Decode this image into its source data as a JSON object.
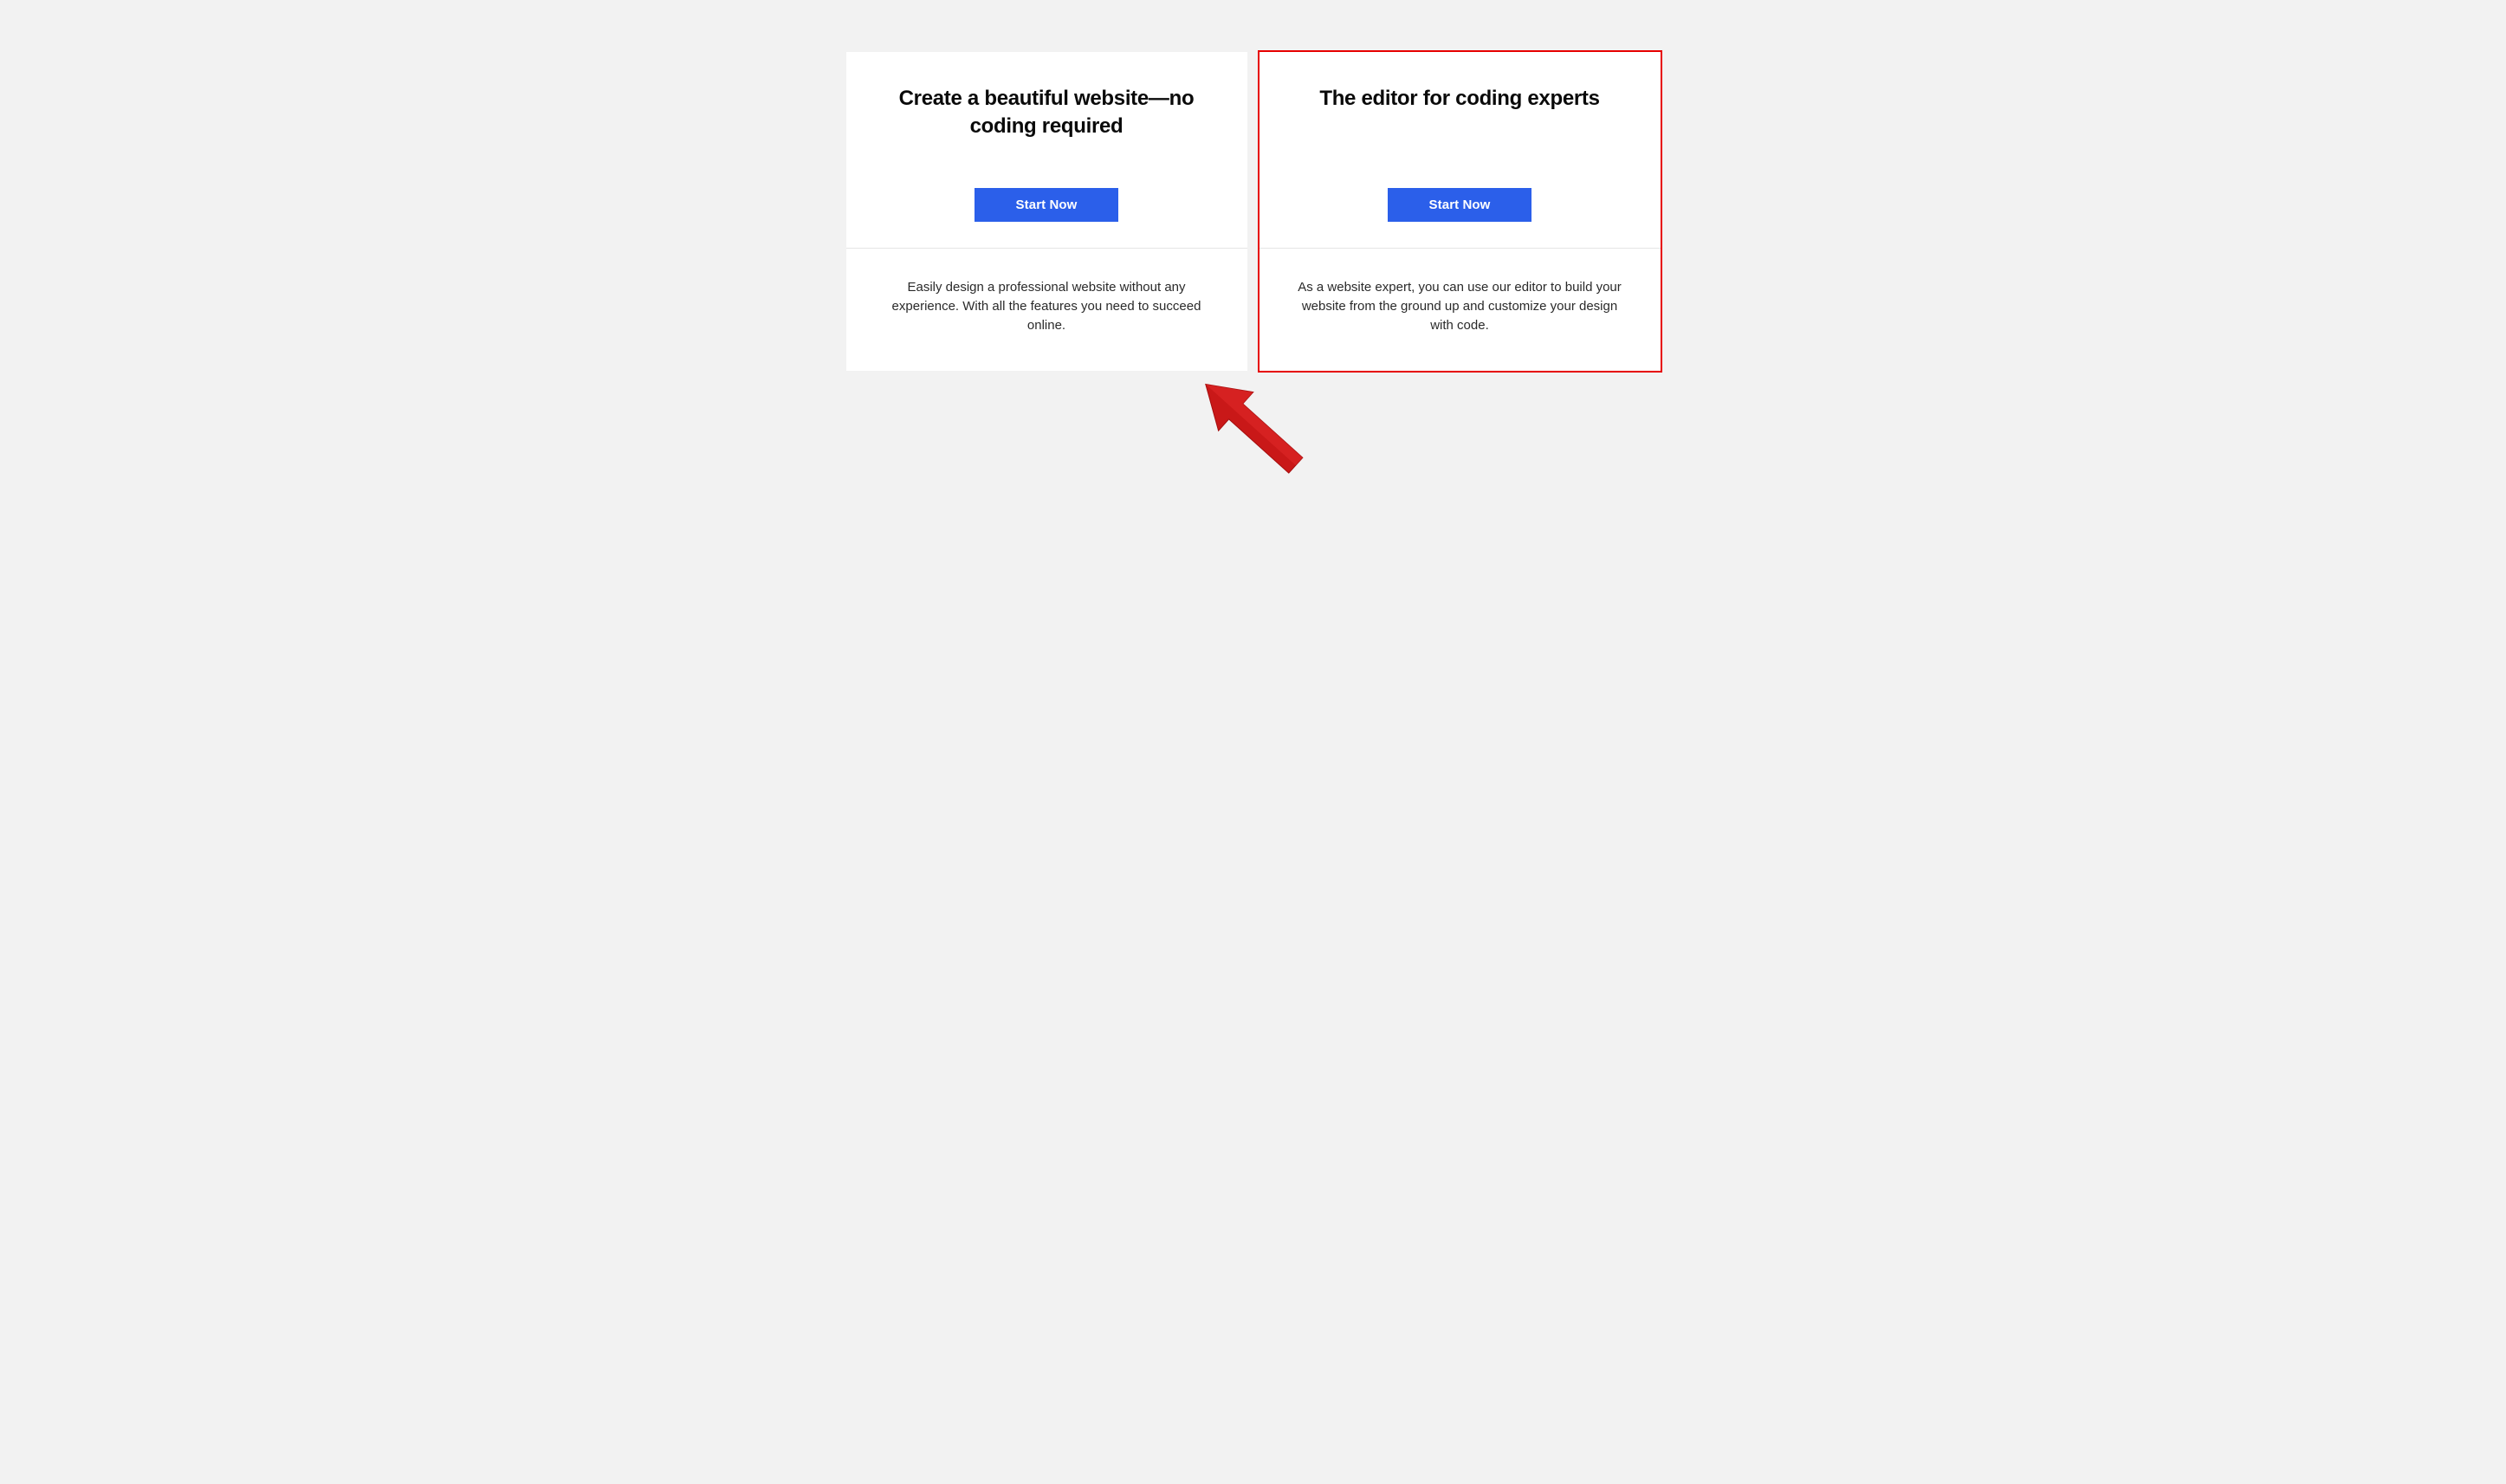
{
  "cards": [
    {
      "title": "Create a beautiful website—no coding required",
      "button_label": "Start Now",
      "description": "Easily design a professional website without any experience. With all the features you need to succeed online.",
      "highlighted": false
    },
    {
      "title": "The editor for coding experts",
      "button_label": "Start Now",
      "description": "As a website expert, you can use our editor to build your website from the ground up and customize your design with code.",
      "highlighted": true
    }
  ],
  "colors": {
    "button_bg": "#2b5fea",
    "highlight_border": "#e60000",
    "page_bg": "#f2f2f2",
    "arrow_fill": "#c91818",
    "arrow_stroke": "#a50e0e"
  }
}
